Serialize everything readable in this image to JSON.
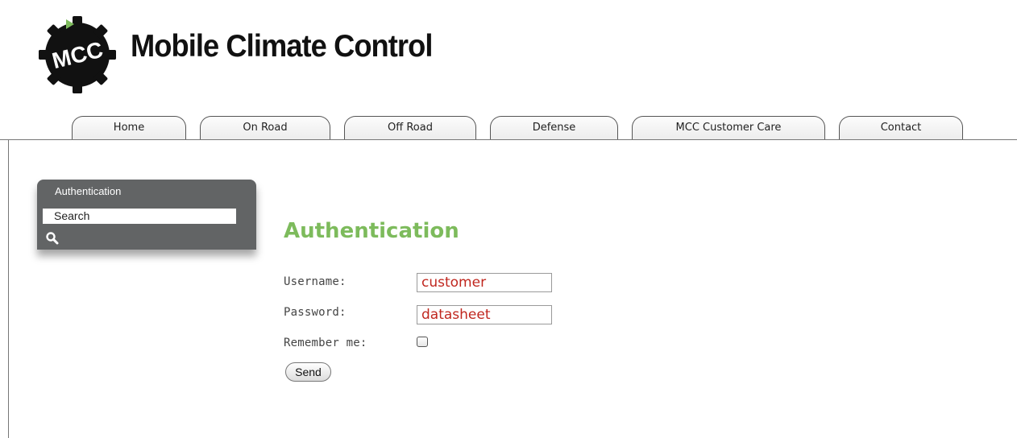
{
  "brand": {
    "logo_text": "MCC",
    "title": "Mobile Climate Control"
  },
  "nav": {
    "tabs": [
      {
        "label": "Home"
      },
      {
        "label": "On Road"
      },
      {
        "label": "Off Road"
      },
      {
        "label": "Defense"
      },
      {
        "label": "MCC Customer Care"
      },
      {
        "label": "Contact"
      }
    ]
  },
  "sidebar": {
    "title": "Authentication",
    "search_value": "Search",
    "search_icon": "magnifier-icon"
  },
  "main": {
    "title": "Authentication",
    "username_label": "Username:",
    "username_value": "customer",
    "password_label": "Password:",
    "password_value": "datasheet",
    "remember_label": "Remember me:",
    "remember_checked": false,
    "send_label": "Send"
  },
  "colors": {
    "title_green": "#7dbb5c",
    "field_text_red": "#c0271f",
    "sidebar_bg": "#626465"
  }
}
